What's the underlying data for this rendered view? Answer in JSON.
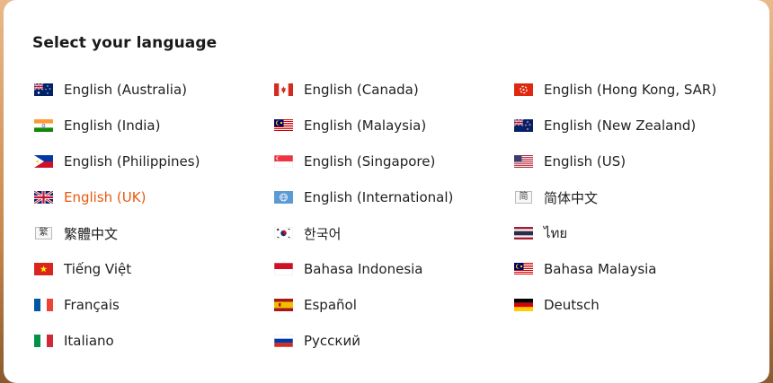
{
  "dialog": {
    "title": "Select your language"
  },
  "languages": [
    {
      "label": "English (Australia)",
      "icon": "flag-australia-icon",
      "selected": false
    },
    {
      "label": "English (Canada)",
      "icon": "flag-canada-icon",
      "selected": false
    },
    {
      "label": "English (Hong Kong, SAR)",
      "icon": "flag-hong-kong-icon",
      "selected": false
    },
    {
      "label": "English (India)",
      "icon": "flag-india-icon",
      "selected": false
    },
    {
      "label": "English (Malaysia)",
      "icon": "flag-malaysia-icon",
      "selected": false
    },
    {
      "label": "English (New Zealand)",
      "icon": "flag-new-zealand-icon",
      "selected": false
    },
    {
      "label": "English (Philippines)",
      "icon": "flag-philippines-icon",
      "selected": false
    },
    {
      "label": "English (Singapore)",
      "icon": "flag-singapore-icon",
      "selected": false
    },
    {
      "label": "English (US)",
      "icon": "flag-us-icon",
      "selected": false
    },
    {
      "label": "English (UK)",
      "icon": "flag-uk-icon",
      "selected": true
    },
    {
      "label": "English (International)",
      "icon": "globe-icon",
      "selected": false
    },
    {
      "label": "简体中文",
      "icon": "simplified-chinese-icon",
      "icon_text": "简",
      "selected": false
    },
    {
      "label": "繁體中文",
      "icon": "traditional-chinese-icon",
      "icon_text": "繁",
      "selected": false
    },
    {
      "label": "한국어",
      "icon": "flag-korea-icon",
      "selected": false
    },
    {
      "label": "ไทย",
      "icon": "flag-thailand-icon",
      "selected": false
    },
    {
      "label": "Tiếng Việt",
      "icon": "flag-vietnam-icon",
      "selected": false
    },
    {
      "label": "Bahasa Indonesia",
      "icon": "flag-indonesia-icon",
      "selected": false
    },
    {
      "label": "Bahasa Malaysia",
      "icon": "flag-malaysia-icon",
      "selected": false
    },
    {
      "label": "Français",
      "icon": "flag-france-icon",
      "selected": false
    },
    {
      "label": "Español",
      "icon": "flag-spain-icon",
      "selected": false
    },
    {
      "label": "Deutsch",
      "icon": "flag-germany-icon",
      "selected": false
    },
    {
      "label": "Italiano",
      "icon": "flag-italy-icon",
      "selected": false
    },
    {
      "label": "Русский",
      "icon": "flag-russia-icon",
      "selected": false
    }
  ],
  "colors": {
    "selected_text": "#e8590c",
    "text": "#1f1f1f",
    "title": "#1a1a1a"
  }
}
